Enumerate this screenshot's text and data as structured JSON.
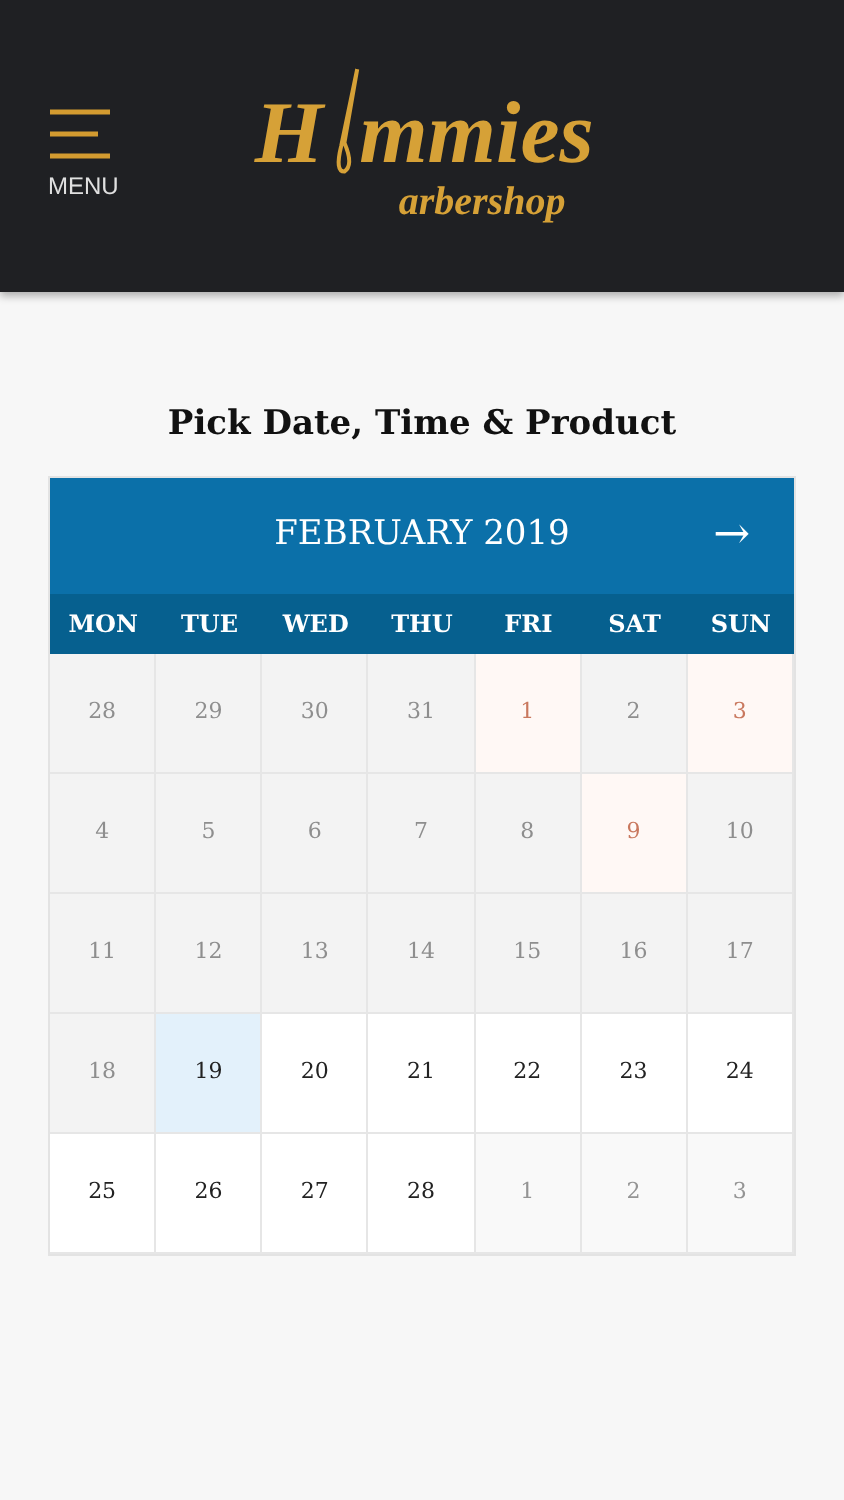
{
  "header": {
    "menu_label": "MENU",
    "logo": {
      "first": "H",
      "rest": "mmies",
      "sub": "arbershop"
    }
  },
  "title": "Pick Date, Time & Product",
  "calendar": {
    "month": "FEBRUARY 2019",
    "next_symbol": "→",
    "weekdays": [
      "MON",
      "TUE",
      "WED",
      "THU",
      "FRI",
      "SAT",
      "SUN"
    ],
    "days": [
      {
        "label": "28",
        "kind": "past",
        "selected": false
      },
      {
        "label": "29",
        "kind": "past",
        "selected": false
      },
      {
        "label": "30",
        "kind": "past",
        "selected": false
      },
      {
        "label": "31",
        "kind": "past",
        "selected": false
      },
      {
        "label": "1",
        "kind": "closed",
        "selected": false
      },
      {
        "label": "2",
        "kind": "past",
        "selected": false
      },
      {
        "label": "3",
        "kind": "closed",
        "selected": false
      },
      {
        "label": "4",
        "kind": "past",
        "selected": false
      },
      {
        "label": "5",
        "kind": "past",
        "selected": false
      },
      {
        "label": "6",
        "kind": "past",
        "selected": false
      },
      {
        "label": "7",
        "kind": "past",
        "selected": false
      },
      {
        "label": "8",
        "kind": "past",
        "selected": false
      },
      {
        "label": "9",
        "kind": "closed",
        "selected": false
      },
      {
        "label": "10",
        "kind": "past",
        "selected": false
      },
      {
        "label": "11",
        "kind": "past",
        "selected": false
      },
      {
        "label": "12",
        "kind": "past",
        "selected": false
      },
      {
        "label": "13",
        "kind": "past",
        "selected": false
      },
      {
        "label": "14",
        "kind": "past",
        "selected": false
      },
      {
        "label": "15",
        "kind": "past",
        "selected": false
      },
      {
        "label": "16",
        "kind": "past",
        "selected": false
      },
      {
        "label": "17",
        "kind": "past",
        "selected": false
      },
      {
        "label": "18",
        "kind": "past",
        "selected": false
      },
      {
        "label": "19",
        "kind": "open",
        "selected": true
      },
      {
        "label": "20",
        "kind": "open",
        "selected": false
      },
      {
        "label": "21",
        "kind": "open",
        "selected": false
      },
      {
        "label": "22",
        "kind": "open",
        "selected": false
      },
      {
        "label": "23",
        "kind": "open",
        "selected": false
      },
      {
        "label": "24",
        "kind": "open",
        "selected": false
      },
      {
        "label": "25",
        "kind": "open",
        "selected": false
      },
      {
        "label": "26",
        "kind": "open",
        "selected": false
      },
      {
        "label": "27",
        "kind": "open",
        "selected": false
      },
      {
        "label": "28",
        "kind": "open",
        "selected": false
      },
      {
        "label": "1",
        "kind": "next",
        "selected": false
      },
      {
        "label": "2",
        "kind": "next",
        "selected": false
      },
      {
        "label": "3",
        "kind": "next",
        "selected": false
      }
    ]
  }
}
